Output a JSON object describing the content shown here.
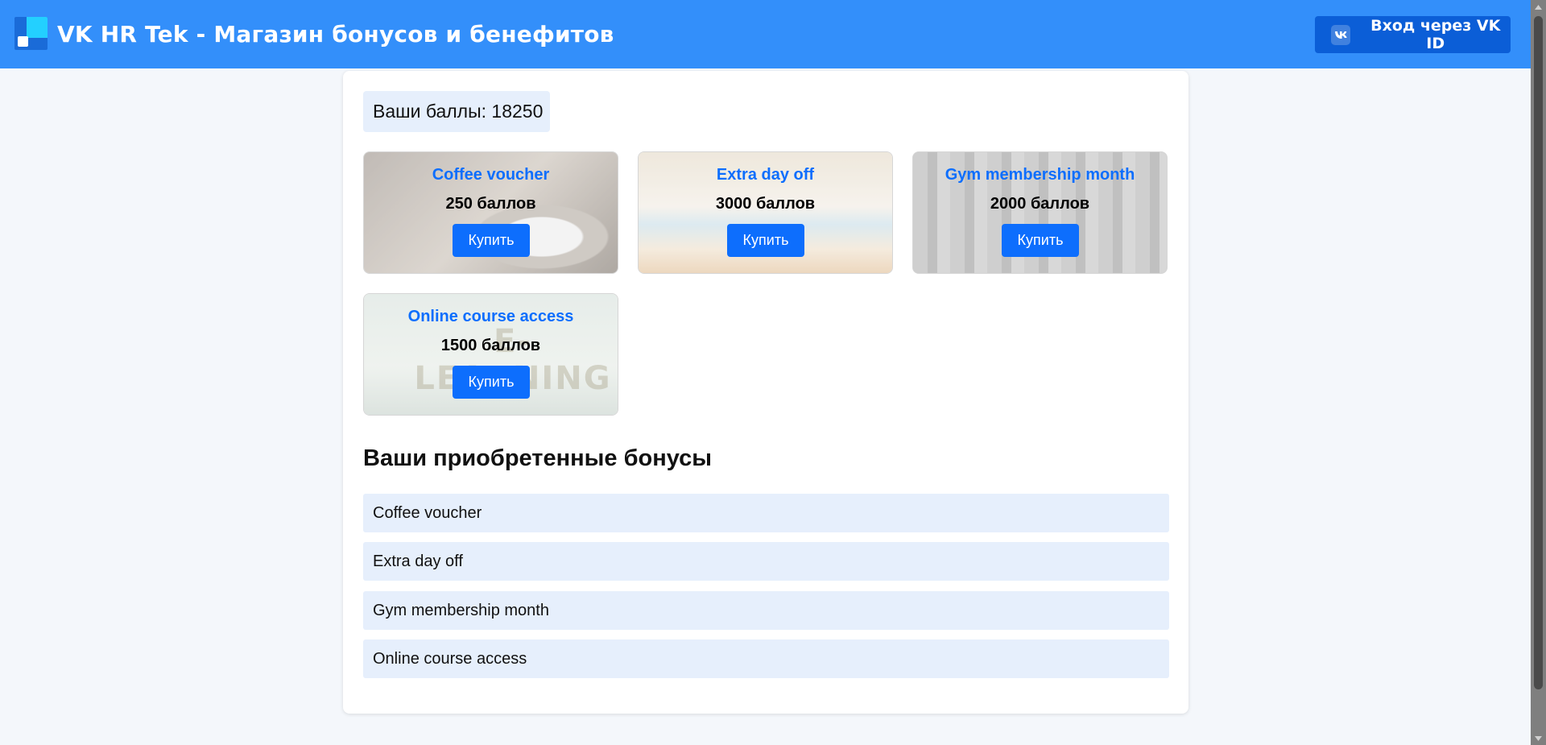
{
  "header": {
    "title": "VK HR Tek - Магазин бонусов и бенефитов",
    "login_label": "Вход через VK ID",
    "brand_color": "#338ffa"
  },
  "points": {
    "text": "Ваши баллы: 18250"
  },
  "products": [
    {
      "name": "Coffee voucher",
      "price": "250 баллов",
      "buy_label": "Купить"
    },
    {
      "name": "Extra day off",
      "price": "3000 баллов",
      "buy_label": "Купить"
    },
    {
      "name": "Gym membership month",
      "price": "2000 баллов",
      "buy_label": "Купить"
    },
    {
      "name": "Online course access",
      "price": "1500 баллов",
      "buy_label": "Купить",
      "image_text": "E-LEARNING"
    }
  ],
  "purchased": {
    "title": "Ваши приобретенные бонусы",
    "items": [
      "Coffee voucher",
      "Extra day off",
      "Gym membership month",
      "Online course access"
    ]
  },
  "colors": {
    "accent": "#0d6efd",
    "light_bg": "#e6effc"
  }
}
